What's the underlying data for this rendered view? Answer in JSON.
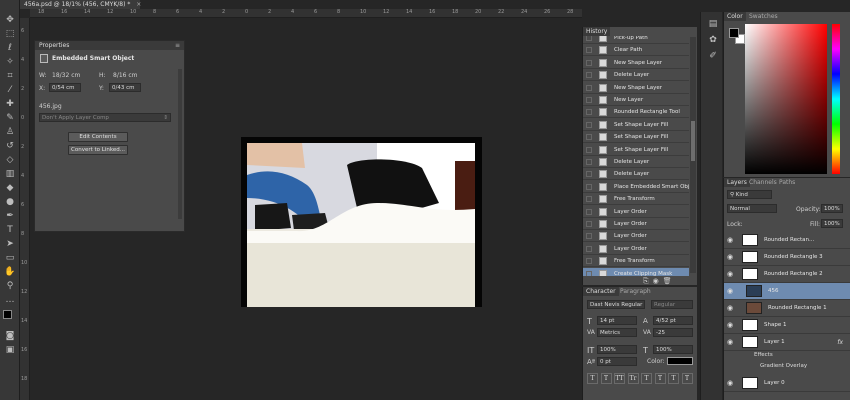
{
  "document": {
    "tab_title": "456a.psd @ 18/1% (456, CMYK/8) *"
  },
  "ruler": {
    "top_ticks": [
      "18",
      "16",
      "14",
      "12",
      "10",
      "8",
      "6",
      "4",
      "2",
      "0",
      "2",
      "4",
      "6",
      "8",
      "10",
      "12",
      "14",
      "16",
      "18",
      "20",
      "22",
      "24",
      "26",
      "28"
    ],
    "left_ticks": [
      "6",
      "4",
      "2",
      "0",
      "2",
      "4",
      "6",
      "8",
      "10",
      "12",
      "14",
      "16",
      "18"
    ]
  },
  "properties": {
    "title": "Properties",
    "heading": "Embedded Smart Object",
    "w_label": "W:",
    "w_value": "18/32 cm",
    "h_label": "H:",
    "h_value": "8/16 cm",
    "x_label": "X:",
    "x_value": "0/54 cm",
    "y_label": "Y:",
    "y_value": "0/43 cm",
    "file_name": "456.jpg",
    "layer_comp": "Don't Apply Layer Comp",
    "edit_contents": "Edit Contents",
    "convert_linked": "Convert to Linked..."
  },
  "history": {
    "tab": "History",
    "items": [
      "Pick-up Path",
      "Clear Path",
      "New Shape Layer",
      "Delete Layer",
      "New Shape Layer",
      "New Layer",
      "Rounded Rectangle Tool",
      "Set Shape Layer Fill",
      "Set Shape Layer Fill",
      "Set Shape Layer Fill",
      "Delete Layer",
      "Delete Layer",
      "Place Embedded Smart Obj...",
      "Free Transform",
      "Layer Order",
      "Layer Order",
      "Layer Order",
      "Layer Order",
      "Free Transform",
      "Create Clipping Mask"
    ],
    "selected_index": 19
  },
  "character": {
    "tab": "Character",
    "tab2": "Paragraph",
    "font_family": "Dast Nevis Regular",
    "font_style": "Regular",
    "size": "14 pt",
    "leading": "4/52 pt",
    "kerning": "Metrics",
    "tracking": "-25",
    "vscale": "100%",
    "hscale": "100%",
    "baseline": "0 pt",
    "color_label": "Color:",
    "style_buttons": [
      "T",
      "T",
      "TT",
      "Tr",
      "T",
      "T",
      "T",
      "T"
    ],
    "color_value": "#000000"
  },
  "color_panel": {
    "tab": "Color",
    "tab2": "Swatches",
    "foreground": "#000000",
    "background": "#ffffff"
  },
  "layers": {
    "tab": "Layers",
    "tab2": "Channels",
    "tab3": "Paths",
    "filter_kind": "Kind",
    "blend_mode": "Normal",
    "opacity_label": "Opacity:",
    "opacity": "100%",
    "lock_label": "Lock:",
    "fill_label": "Fill:",
    "fill": "100%",
    "items": [
      {
        "name": "Rounded Rectan...",
        "selected": false
      },
      {
        "name": "Rounded Rectangle 3",
        "selected": false
      },
      {
        "name": "Rounded Rectangle 2",
        "selected": false
      },
      {
        "name": "456",
        "selected": true
      },
      {
        "name": "Rounded Rectangle 1",
        "selected": false
      },
      {
        "name": "Shape 1",
        "selected": false
      },
      {
        "name": "Layer 1",
        "selected": false
      },
      {
        "name": "Layer 0",
        "selected": false
      }
    ],
    "effects_label": "Effects",
    "gradient_overlay": "Gradient Overlay",
    "fx": "fx"
  }
}
